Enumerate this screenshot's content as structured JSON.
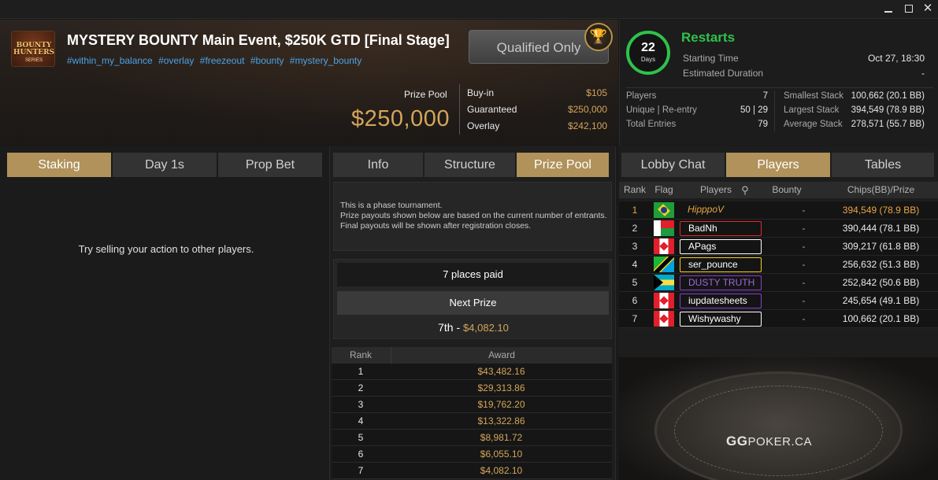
{
  "window": {
    "min_glyph": "",
    "max_glyph": "",
    "close_glyph": "✕"
  },
  "event": {
    "logo_line1": "BOUNTY",
    "logo_line2": "HUNTERS",
    "logo_sub": "SERIES",
    "title": "MYSTERY BOUNTY Main Event, $250K GTD [Final Stage]",
    "hashtags": [
      "#within_my_balance",
      "#overlay",
      "#freezeout",
      "#bounty",
      "#mystery_bounty"
    ],
    "qualified_label": "Qualified Only",
    "trophy_icon": "trophy-icon",
    "prize_pool_label": "Prize Pool",
    "prize_pool_value": "$250,000",
    "buyin_label": "Buy-in",
    "buyin_value": "$105",
    "guaranteed_label": "Guaranteed",
    "guaranteed_value": "$250,000",
    "overlay_label": "Overlay",
    "overlay_value": "$242,100"
  },
  "status": {
    "days_num": "22",
    "days_label": "Days",
    "title": "Restarts",
    "starting_time_label": "Starting Time",
    "starting_time_value": "Oct 27, 18:30",
    "duration_label": "Estimated Duration",
    "duration_value": "-",
    "players_label": "Players",
    "players_value": "7",
    "unique_label": "Unique | Re-entry",
    "unique_value": "50 | 29",
    "entries_label": "Total Entries",
    "entries_value": "79",
    "smallest_label": "Smallest Stack",
    "smallest_value": "100,662 (20.1 BB)",
    "largest_label": "Largest Stack",
    "largest_value": "394,549 (78.9 BB)",
    "average_label": "Average Stack",
    "average_value": "278,571 (55.7 BB)"
  },
  "left_panel": {
    "tabs": [
      "Staking",
      "Day 1s",
      "Prop Bet"
    ],
    "message": "Try selling your action to other players."
  },
  "mid_panel": {
    "tabs": [
      "Info",
      "Structure",
      "Prize Pool"
    ],
    "notice_lines": [
      "This is a phase tournament.",
      "Prize payouts shown below are based on the current number of entrants.",
      "Final payouts will be shown after registration closes."
    ],
    "places_paid": "7 places paid",
    "next_prize_label": "Next Prize",
    "next_prize_place": "7th",
    "next_prize_sep": "-",
    "next_prize_amount": "$4,082.10",
    "award_headers": [
      "Rank",
      "Award"
    ],
    "awards": [
      {
        "rank": "1",
        "award": "$43,482.16"
      },
      {
        "rank": "2",
        "award": "$29,313.86"
      },
      {
        "rank": "3",
        "award": "$19,762.20"
      },
      {
        "rank": "4",
        "award": "$13,322.86"
      },
      {
        "rank": "5",
        "award": "$8,981.72"
      },
      {
        "rank": "6",
        "award": "$6,055.10"
      },
      {
        "rank": "7",
        "award": "$4,082.10"
      }
    ]
  },
  "right_panel": {
    "tabs": [
      "Lobby Chat",
      "Players",
      "Tables"
    ],
    "headers": {
      "rank": "Rank",
      "flag": "Flag",
      "players": "Players",
      "bounty": "Bounty",
      "chips": "Chips(BB)/Prize"
    },
    "players": [
      {
        "rank": "1",
        "flag": "brazil",
        "name": "HipppoV",
        "bounty": "-",
        "chips": "394,549 (78.9 BB)",
        "name_color": "#e8a640"
      },
      {
        "rank": "2",
        "flag": "madagascar",
        "name": "BadNh",
        "bounty": "-",
        "chips": "390,444 (78.1 BB)",
        "name_color": "#e02a2a"
      },
      {
        "rank": "3",
        "flag": "canada",
        "name": "APags",
        "bounty": "-",
        "chips": "309,217 (61.8 BB)",
        "name_color": "#ffffff"
      },
      {
        "rank": "4",
        "flag": "tanzania",
        "name": "ser_pounce",
        "bounty": "-",
        "chips": "256,632 (51.3 BB)",
        "name_color": "#f4d01c"
      },
      {
        "rank": "5",
        "flag": "bahamas",
        "name": "DUSTY TRUTH",
        "bounty": "-",
        "chips": "252,842 (50.6 BB)",
        "name_color": "#8a3fd0"
      },
      {
        "rank": "6",
        "flag": "canada",
        "name": "iupdatesheets",
        "bounty": "-",
        "chips": "245,654 (49.1 BB)",
        "name_color": "#8a3fd0"
      },
      {
        "rank": "7",
        "flag": "canada",
        "name": "Wishywashy",
        "bounty": "-",
        "chips": "100,662 (20.1 BB)",
        "name_color": "#ffffff"
      }
    ],
    "brand_gg": "GG",
    "brand_rest": "POKER.CA"
  },
  "colors": {
    "accent_gold": "#d4a55a",
    "tab_active": "#b0925a",
    "green": "#2fc24a",
    "link_blue": "#4aa3e8"
  }
}
